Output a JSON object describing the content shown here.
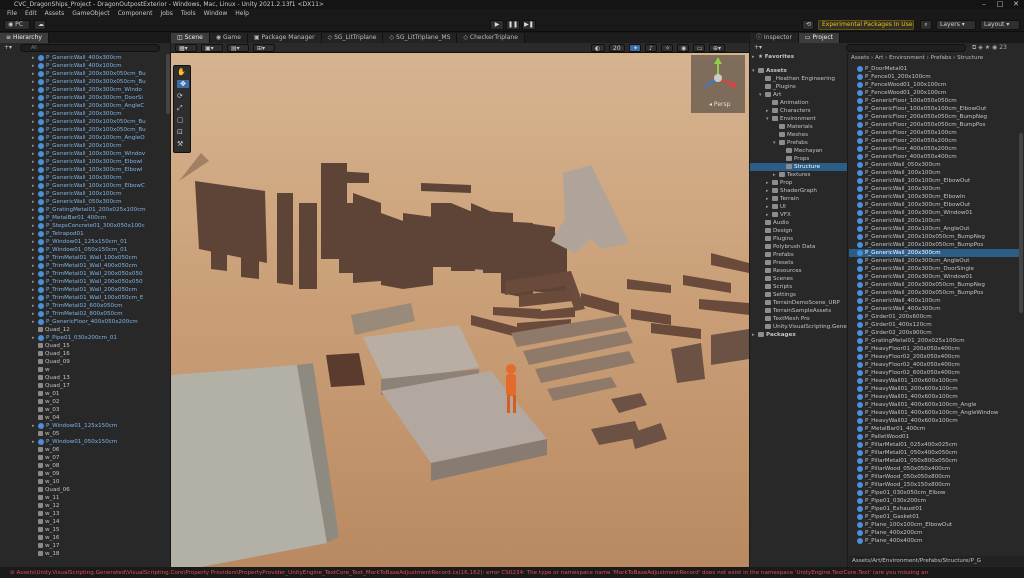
{
  "window": {
    "title": "CVC_DragonShips_Project - DragonOutpostExterior - Windows, Mac, Linux - Unity 2021.2.13f1 <DX11>",
    "min": "–",
    "max": "□",
    "close": "✕"
  },
  "menu": [
    "File",
    "Edit",
    "Assets",
    "GameObject",
    "Component",
    "Jobs",
    "Tools",
    "Window",
    "Help"
  ],
  "toolbar": {
    "account": "PC",
    "experimental": "Experimental Packages In Use",
    "layers": "Layers",
    "layout": "Layout"
  },
  "hierarchy": {
    "tab": "Hierarchy",
    "search_placeholder": "All",
    "items": [
      {
        "label": "P_GenericWall_400x300cm",
        "type": "prefab",
        "arrow": "▸",
        "indent": 1
      },
      {
        "label": "P_GenericWall_400x100cm",
        "type": "prefab",
        "arrow": "▸",
        "indent": 1
      },
      {
        "label": "P_GenericWall_200x300x050cm_Bu",
        "type": "prefab",
        "arrow": "▸",
        "indent": 1
      },
      {
        "label": "P_GenericWall_200x300x050cm_Bu",
        "type": "prefab",
        "arrow": "▸",
        "indent": 1
      },
      {
        "label": "P_GenericWall_200x300cm_Windo",
        "type": "prefab",
        "arrow": "▸",
        "indent": 1
      },
      {
        "label": "P_GenericWall_200x300cm_DoorSi",
        "type": "prefab",
        "arrow": "▸",
        "indent": 1
      },
      {
        "label": "P_GenericWall_200x300cm_AngleC",
        "type": "prefab",
        "arrow": "▸",
        "indent": 1
      },
      {
        "label": "P_GenericWall_200x300cm",
        "type": "prefab",
        "arrow": "▸",
        "indent": 1
      },
      {
        "label": "P_GenericWall_200x100x050cm_Bu",
        "type": "prefab",
        "arrow": "▸",
        "indent": 1
      },
      {
        "label": "P_GenericWall_200x100x050cm_Bu",
        "type": "prefab",
        "arrow": "▸",
        "indent": 1
      },
      {
        "label": "P_GenericWall_200x100cm_AngleO",
        "type": "prefab",
        "arrow": "▸",
        "indent": 1
      },
      {
        "label": "P_GenericWall_200x100cm",
        "type": "prefab",
        "arrow": "▸",
        "indent": 1
      },
      {
        "label": "P_GenericWall_100x300cm_Windov",
        "type": "prefab",
        "arrow": "▸",
        "indent": 1
      },
      {
        "label": "P_GenericWall_100x300cm_Elbowl",
        "type": "prefab",
        "arrow": "▸",
        "indent": 1
      },
      {
        "label": "P_GenericWall_100x300cm_Elbowl",
        "type": "prefab",
        "arrow": "▸",
        "indent": 1
      },
      {
        "label": "P_GenericWall_100x300cm",
        "type": "prefab",
        "arrow": "▸",
        "indent": 1
      },
      {
        "label": "P_GenericWall_100x100cm_ElbowC",
        "type": "prefab",
        "arrow": "▸",
        "indent": 1
      },
      {
        "label": "P_GenericWall_100x100cm",
        "type": "prefab",
        "arrow": "▸",
        "indent": 1
      },
      {
        "label": "P_GenericWall_050x300cm",
        "type": "prefab",
        "arrow": "▸",
        "indent": 1
      },
      {
        "label": "P_GratingMetal01_200x025x100cm",
        "type": "prefab",
        "arrow": "▸",
        "indent": 1
      },
      {
        "label": "P_MetalBar01_400cm",
        "type": "prefab",
        "arrow": "▸",
        "indent": 1
      },
      {
        "label": "P_StepsConcrete01_300x050x100c",
        "type": "prefab",
        "arrow": "▸",
        "indent": 1
      },
      {
        "label": "P_Tetrapod01",
        "type": "prefab",
        "arrow": "▸",
        "indent": 1
      },
      {
        "label": "P_Window01_125x150cm_01",
        "type": "prefab",
        "arrow": "▸",
        "indent": 1
      },
      {
        "label": "P_Window01_050x150cm_01",
        "type": "prefab",
        "arrow": "▸",
        "indent": 1
      },
      {
        "label": "P_TrimMetal01_Wall_100x050cm",
        "type": "prefab",
        "arrow": "▸",
        "indent": 1
      },
      {
        "label": "P_TrimMetal01_Wall_400x050cm",
        "type": "prefab",
        "arrow": "▸",
        "indent": 1
      },
      {
        "label": "P_TrimMetal01_Wall_200x050x050",
        "type": "prefab",
        "arrow": "▸",
        "indent": 1
      },
      {
        "label": "P_TrimMetal01_Wall_200x050x050",
        "type": "prefab",
        "arrow": "▸",
        "indent": 1
      },
      {
        "label": "P_TrimMetal01_Wall_200x050cm",
        "type": "prefab",
        "arrow": "▸",
        "indent": 1
      },
      {
        "label": "P_TrimMetal01_Wall_100x050cm_E",
        "type": "prefab",
        "arrow": "▸",
        "indent": 1
      },
      {
        "label": "P_TrimMetal02_600x050cm",
        "type": "prefab",
        "arrow": "▸",
        "indent": 1
      },
      {
        "label": "P_TrimMetal02_800x050cm",
        "type": "prefab",
        "arrow": "▸",
        "indent": 1
      },
      {
        "label": "P_GenericFloor_400x050x200cm",
        "type": "prefab",
        "arrow": "▸",
        "indent": 1
      },
      {
        "label": "Quad_12",
        "type": "object",
        "arrow": "",
        "indent": 1
      },
      {
        "label": "P_Pipe01_030x200cm_01",
        "type": "prefab",
        "arrow": "▸",
        "indent": 1
      },
      {
        "label": "Quad_15",
        "type": "object",
        "arrow": "",
        "indent": 1
      },
      {
        "label": "Quad_16",
        "type": "object",
        "arrow": "",
        "indent": 1
      },
      {
        "label": "Quad_09",
        "type": "object",
        "arrow": "",
        "indent": 1
      },
      {
        "label": "w",
        "type": "object",
        "arrow": "",
        "indent": 1
      },
      {
        "label": "Quad_13",
        "type": "object",
        "arrow": "",
        "indent": 1
      },
      {
        "label": "Quad_17",
        "type": "object",
        "arrow": "",
        "indent": 1
      },
      {
        "label": "w_01",
        "type": "object",
        "arrow": "",
        "indent": 1
      },
      {
        "label": "w_02",
        "type": "object",
        "arrow": "",
        "indent": 1
      },
      {
        "label": "w_03",
        "type": "object",
        "arrow": "",
        "indent": 1
      },
      {
        "label": "w_04",
        "type": "object",
        "arrow": "",
        "indent": 1
      },
      {
        "label": "P_Window01_125x150cm",
        "type": "prefab",
        "arrow": "▸",
        "indent": 1
      },
      {
        "label": "w_05",
        "type": "object",
        "arrow": "",
        "indent": 1
      },
      {
        "label": "P_Window01_050x150cm",
        "type": "prefab",
        "arrow": "▸",
        "indent": 1
      },
      {
        "label": "w_06",
        "type": "object",
        "arrow": "",
        "indent": 1
      },
      {
        "label": "w_07",
        "type": "object",
        "arrow": "",
        "indent": 1
      },
      {
        "label": "w_08",
        "type": "object",
        "arrow": "",
        "indent": 1
      },
      {
        "label": "w_09",
        "type": "object",
        "arrow": "",
        "indent": 1
      },
      {
        "label": "w_10",
        "type": "object",
        "arrow": "",
        "indent": 1
      },
      {
        "label": "Quad_06",
        "type": "object",
        "arrow": "",
        "indent": 1
      },
      {
        "label": "w_11",
        "type": "object",
        "arrow": "",
        "indent": 1
      },
      {
        "label": "w_12",
        "type": "object",
        "arrow": "",
        "indent": 1
      },
      {
        "label": "w_13",
        "type": "object",
        "arrow": "",
        "indent": 1
      },
      {
        "label": "w_14",
        "type": "object",
        "arrow": "",
        "indent": 1
      },
      {
        "label": "w_15",
        "type": "object",
        "arrow": "",
        "indent": 1
      },
      {
        "label": "w_16",
        "type": "object",
        "arrow": "",
        "indent": 1
      },
      {
        "label": "w_17",
        "type": "object",
        "arrow": "",
        "indent": 1
      },
      {
        "label": "w_18",
        "type": "object",
        "arrow": "",
        "indent": 1
      }
    ]
  },
  "scene": {
    "tabs": [
      "Scene",
      "Game",
      "Package Manager",
      "SG_LitTriplane",
      "SG_LitTriplane_MS",
      "CheckerTriplane"
    ],
    "active_tab": 0,
    "gizmo_label": "Persp",
    "grid_number": "20"
  },
  "inspector": {
    "tabs": [
      "Inspector",
      "Project"
    ],
    "active_tab": 1,
    "search_placeholder": "",
    "favorites": "Favorites",
    "tree": [
      {
        "label": "Assets",
        "indent": 0,
        "arrow": "▾"
      },
      {
        "label": "_Heathen Engineering",
        "indent": 1,
        "arrow": ""
      },
      {
        "label": "_Plugins",
        "indent": 1,
        "arrow": ""
      },
      {
        "label": "Art",
        "indent": 1,
        "arrow": "▾"
      },
      {
        "label": "Animation",
        "indent": 2,
        "arrow": ""
      },
      {
        "label": "Characters",
        "indent": 2,
        "arrow": "▸"
      },
      {
        "label": "Environment",
        "indent": 2,
        "arrow": "▾"
      },
      {
        "label": "Materials",
        "indent": 3,
        "arrow": ""
      },
      {
        "label": "Meshes",
        "indent": 3,
        "arrow": ""
      },
      {
        "label": "Prefabs",
        "indent": 3,
        "arrow": "▾"
      },
      {
        "label": "Mechayan",
        "indent": 4,
        "arrow": ""
      },
      {
        "label": "Props",
        "indent": 4,
        "arrow": ""
      },
      {
        "label": "Structure",
        "indent": 4,
        "arrow": "",
        "selected": true
      },
      {
        "label": "Textures",
        "indent": 3,
        "arrow": "▸"
      },
      {
        "label": "Prop",
        "indent": 2,
        "arrow": "▸"
      },
      {
        "label": "ShaderGraph",
        "indent": 2,
        "arrow": "▸"
      },
      {
        "label": "Terrain",
        "indent": 2,
        "arrow": "▸"
      },
      {
        "label": "UI",
        "indent": 2,
        "arrow": "▸"
      },
      {
        "label": "VFX",
        "indent": 2,
        "arrow": "▸"
      },
      {
        "label": "Audio",
        "indent": 1,
        "arrow": ""
      },
      {
        "label": "Design",
        "indent": 1,
        "arrow": ""
      },
      {
        "label": "Plugins",
        "indent": 1,
        "arrow": ""
      },
      {
        "label": "Polybrush Data",
        "indent": 1,
        "arrow": ""
      },
      {
        "label": "Prefabs",
        "indent": 1,
        "arrow": ""
      },
      {
        "label": "Presets",
        "indent": 1,
        "arrow": ""
      },
      {
        "label": "Resources",
        "indent": 1,
        "arrow": ""
      },
      {
        "label": "Scenes",
        "indent": 1,
        "arrow": ""
      },
      {
        "label": "Scripts",
        "indent": 1,
        "arrow": ""
      },
      {
        "label": "Settings",
        "indent": 1,
        "arrow": ""
      },
      {
        "label": "TerrainDemoScene_URP",
        "indent": 1,
        "arrow": ""
      },
      {
        "label": "TerrainSampleAssets",
        "indent": 1,
        "arrow": ""
      },
      {
        "label": "TextMesh Pro",
        "indent": 1,
        "arrow": ""
      },
      {
        "label": "Unity.VisualScripting.Gene",
        "indent": 1,
        "arrow": ""
      },
      {
        "label": "Packages",
        "indent": 0,
        "arrow": "▸"
      }
    ]
  },
  "project": {
    "breadcrumb": "Assets › Art › Environment › Prefabs › Structure",
    "path_footer": "Assets/Art/Environment/Prefabs/Structure/P_G",
    "items": [
      "P_DoorMetal01",
      "P_Fence01_200x100cm",
      "P_FenceWood01_100x100cm",
      "P_FenceWood01_200x100cm",
      "P_GenericFloor_100x050x050cm",
      "P_GenericFloor_100x050x100cm_ElbowOut",
      "P_GenericFloor_200x050x050cm_BumpNeg",
      "P_GenericFloor_200x050x050cm_BumpPos",
      "P_GenericFloor_200x050x100cm",
      "P_GenericFloor_200x050x200cm",
      "P_GenericFloor_400x050x200cm",
      "P_GenericFloor_400x050x400cm",
      "P_GenericWall_050x300cm",
      "P_GenericWall_100x100cm",
      "P_GenericWall_100x100cm_ElbowOut",
      "P_GenericWall_100x300cm",
      "P_GenericWall_100x300cm_ElbowIn",
      "P_GenericWall_100x300cm_ElbowOut",
      "P_GenericWall_100x300cm_Window01",
      "P_GenericWall_200x100cm",
      "P_GenericWall_200x100cm_AngleOut",
      "P_GenericWall_200x100x050cm_BumpNeg",
      "P_GenericWall_200x100x050cm_BumpPos",
      "P_GenericWall_200x300cm",
      "P_GenericWall_200x300cm_AngleOut",
      "P_GenericWall_200x300cm_DoorSingle",
      "P_GenericWall_200x300cm_Window01",
      "P_GenericWall_200x300x050cm_BumpNeg",
      "P_GenericWall_200x300x050cm_BumpPos",
      "P_GenericWall_400x100cm",
      "P_GenericWall_400x300cm",
      "P_Girder01_200x600cm",
      "P_Girder01_400x120cm",
      "P_Girder02_200x900cm",
      "P_GratingMetal01_200x025x100cm",
      "P_HeavyFloor01_200x050x400cm",
      "P_HeavyFloor02_200x050x400cm",
      "P_HeavyFloor02_400x050x400cm",
      "P_HeavyFloor02_600x050x400cm",
      "P_HeavyWall01_100x600x100cm",
      "P_HeavyWall01_200x600x100cm",
      "P_HeavyWall01_400x600x100cm",
      "P_HeavyWall01_400x600x100cm_Angle",
      "P_HeavyWall01_400x600x100cm_AngleWindow",
      "P_HeavyWall02_400x600x100cm",
      "P_MetalBar01_400cm",
      "P_PalletWood01",
      "P_PillarMetal01_025x400x025cm",
      "P_PillarMetal01_050x400x050cm",
      "P_PillarMetal01_050x800x050cm",
      "P_PillarWood_050x050x400cm",
      "P_PillarWood_050x050x800cm",
      "P_PillarWood_150x150x800cm",
      "P_Pipe01_030x050cm_Elbow",
      "P_Pipe01_030x200cm",
      "P_Pipe01_Exhaust01",
      "P_Pipe01_Gasket01",
      "P_Plane_100x100cm_ElbowOut",
      "P_Plane_400x200cm",
      "P_Plane_400x400cm"
    ],
    "selected_index": 23,
    "slider_count": "23"
  },
  "console": {
    "message": "Assets\\Unity.VisualScripting.Generated\\VisualScripting.Core\\Property Providers\\PropertyProvider_UnityEngine_TextCore_Text_MarkToBaseAdjustmentRecord.cs(16,162): error CS0234: The type or namespace name 'MarkToBaseAdjustmentRecord' does not exist in the namespace 'UnityEngine.TextCore.Text' (are you missing an"
  },
  "colors": {
    "accent": "#2c5d87",
    "prefab_text": "#7cb4e8",
    "error": "#e05050",
    "sand": "#c8a27d"
  }
}
